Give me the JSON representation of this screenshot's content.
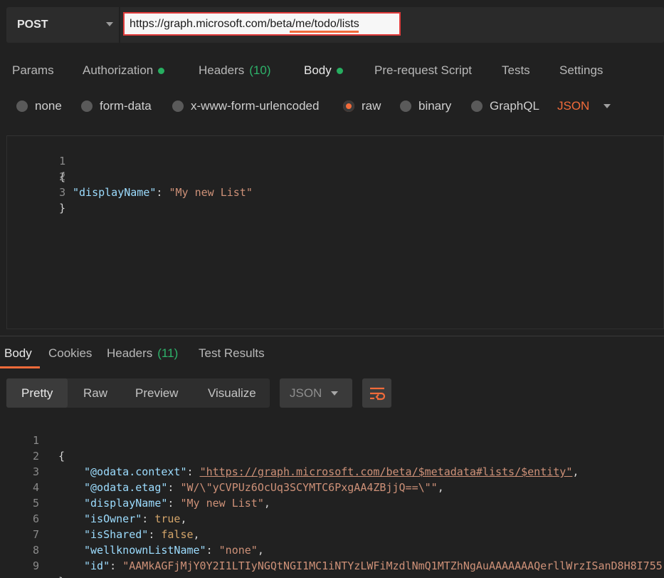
{
  "request": {
    "method": "POST",
    "url": "https://graph.microsoft.com/beta/me/todo/lists"
  },
  "request_tabs": [
    {
      "label": "Params"
    },
    {
      "label": "Authorization",
      "dot": true
    },
    {
      "label": "Headers",
      "count": "(10)"
    },
    {
      "label": "Body",
      "dot": true,
      "active": true
    },
    {
      "label": "Pre-request Script"
    },
    {
      "label": "Tests"
    },
    {
      "label": "Settings"
    }
  ],
  "body_types": {
    "none": "none",
    "form_data": "form-data",
    "urlencoded": "x-www-form-urlencoded",
    "raw": "raw",
    "binary": "binary",
    "graphql": "GraphQL",
    "selected": "raw",
    "format": "JSON"
  },
  "request_body": {
    "line_numbers": [
      "1",
      "2",
      "3"
    ],
    "open_brace": "{",
    "key": "\"displayName\"",
    "colon": ": ",
    "value": "\"My new List\"",
    "close_brace": "}"
  },
  "response_tabs": [
    {
      "label": "Body",
      "active": true
    },
    {
      "label": "Cookies"
    },
    {
      "label": "Headers",
      "count": "(11)"
    },
    {
      "label": "Test Results"
    }
  ],
  "view_modes": {
    "pretty": "Pretty",
    "raw": "Raw",
    "preview": "Preview",
    "visualize": "Visualize",
    "format": "JSON"
  },
  "response_body": {
    "line_numbers": [
      "1",
      "2",
      "3",
      "4",
      "5",
      "6",
      "7",
      "8",
      "9"
    ],
    "open_brace": "{",
    "close_brace": "}",
    "context_key": "\"@odata.context\"",
    "context_value": "\"https://graph.microsoft.com/beta/$metadata#lists/$entity\"",
    "etag_key": "\"@odata.etag\"",
    "etag_value": "\"W/\\\"yCVPUz6OcUq3SCYMTC6PxgAA4ZBjjQ==\\\"\"",
    "display_key": "\"displayName\"",
    "display_value": "\"My new List\"",
    "owner_key": "\"isOwner\"",
    "owner_value": "true",
    "shared_key": "\"isShared\"",
    "shared_value": "false",
    "wellknown_key": "\"wellknownListName\"",
    "wellknown_value": "\"none\"",
    "id_key": "\"id\"",
    "id_value": "\"AAMkAGFjMjY0Y2I1LTIyNGQtNGI1MC1iNTYzLWFiMzdlNmQ1MTZhNgAuAAAAAAAQerllWrzISanD8H8I755"
  },
  "colors": {
    "accent": "#f26b3a",
    "green_dot": "#27ae60",
    "url_highlight": "#e03c3c"
  }
}
